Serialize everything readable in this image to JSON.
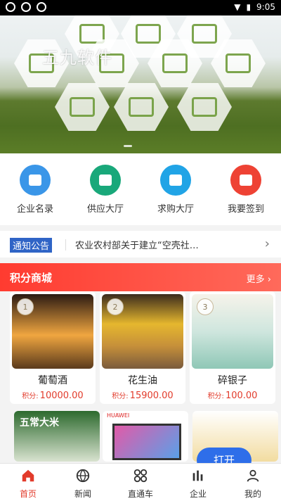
{
  "status": {
    "time": "9:05"
  },
  "banner": {
    "watermark": "五九软件"
  },
  "quick_actions": [
    {
      "label": "企业名录",
      "color": "#3a96e8",
      "icon": "building-icon"
    },
    {
      "label": "供应大厅",
      "color": "#19a87a",
      "icon": "folder-icon"
    },
    {
      "label": "求购大厅",
      "color": "#21a4e6",
      "icon": "shopping-bag-icon"
    },
    {
      "label": "我要签到",
      "color": "#ee4234",
      "icon": "lightning-icon"
    }
  ],
  "notice": {
    "tag": "通知公告",
    "text": "农业农村部关于建立“空壳社…"
  },
  "mall": {
    "title": "积分商城",
    "more": "更多"
  },
  "products": [
    {
      "rank": "1",
      "name": "葡萄酒",
      "points_label": "积分:",
      "points": "10000.00"
    },
    {
      "rank": "2",
      "name": "花生油",
      "points_label": "积分:",
      "points": "15900.00"
    },
    {
      "rank": "3",
      "name": "碎银子",
      "points_label": "积分:",
      "points": "100.00"
    }
  ],
  "bottom_products": [
    {
      "label": "五常大米"
    },
    {
      "label": "HUAWEI"
    }
  ],
  "open_button": "打开",
  "tabs": [
    {
      "label": "首页",
      "icon": "home-icon",
      "active": true
    },
    {
      "label": "新闻",
      "icon": "globe-icon",
      "active": false
    },
    {
      "label": "直通车",
      "icon": "grid-icon",
      "active": false
    },
    {
      "label": "企业",
      "icon": "bar-chart-icon",
      "active": false
    },
    {
      "label": "我的",
      "icon": "person-icon",
      "active": false
    }
  ],
  "colors": {
    "accent": "#e23b2b",
    "notice_tag": "#2f64c6",
    "open_button": "#2e6ee9"
  }
}
